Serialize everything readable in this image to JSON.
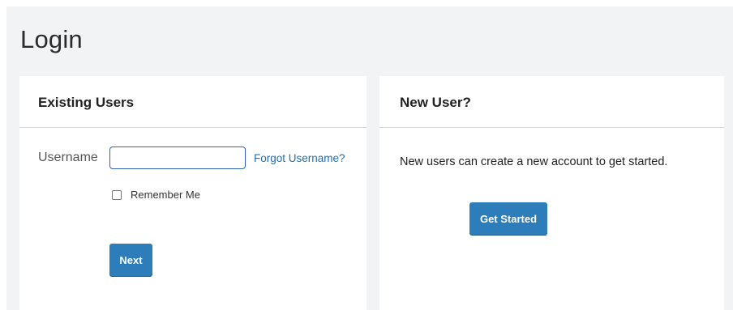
{
  "page": {
    "title": "Login"
  },
  "existing_users": {
    "heading": "Existing Users",
    "username_label": "Username",
    "username_value": "",
    "forgot_username_link": "Forgot Username?",
    "remember_me_label": "Remember Me",
    "remember_me_checked": false,
    "next_button": "Next"
  },
  "new_user": {
    "heading": "New User?",
    "description": "New users can create a new account to get started.",
    "get_started_button": "Get Started"
  },
  "colors": {
    "page_background": "#f2f3f4",
    "panel_background": "#ffffff",
    "primary_button": "#2d7dbb",
    "link": "#1f6fb5",
    "input_focus_border": "#2f63b4"
  }
}
